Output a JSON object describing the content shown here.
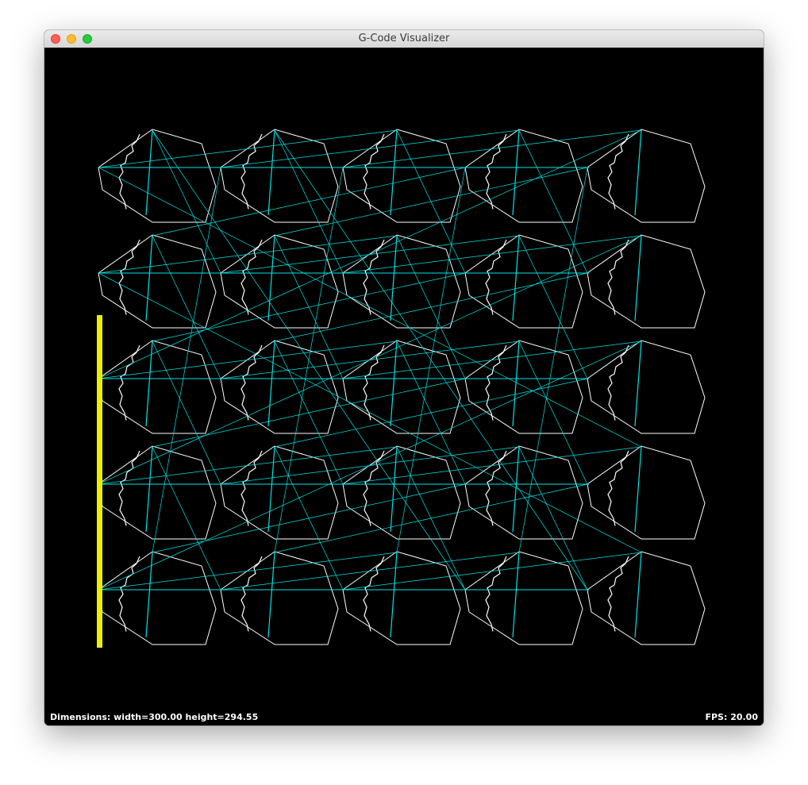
{
  "window": {
    "title": "G-Code Visualizer"
  },
  "status": {
    "dimensions": "Dimensions: width=300.00 height=294.55",
    "fps": "FPS: 20.00"
  },
  "colors": {
    "background": "#000000",
    "outline": "#ffffff",
    "travel": "#00e5e5",
    "tool": "#e8f000"
  },
  "grid": {
    "rows": 5,
    "cols": 5
  }
}
